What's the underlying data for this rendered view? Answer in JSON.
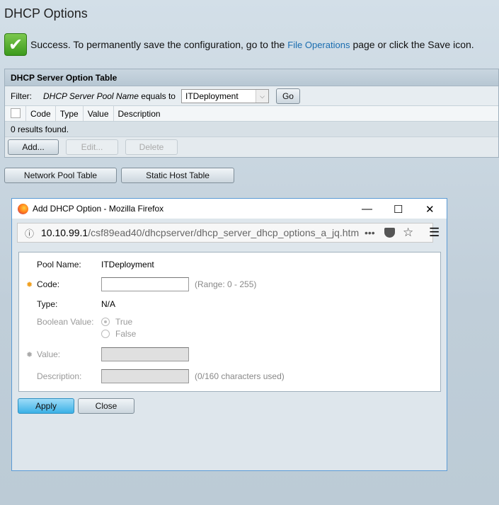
{
  "page": {
    "title": "DHCP Options",
    "success_text": "Success. To permanently save the configuration, go to the",
    "success_link": "File Operations",
    "success_tail": "page or click the Save icon."
  },
  "table": {
    "title": "DHCP Server Option Table",
    "filter_label": "Filter:",
    "filter_field": "DHCP Server Pool Name",
    "filter_op": "equals to",
    "filter_value": "ITDeployment",
    "go": "Go",
    "columns": [
      "Code",
      "Type",
      "Value",
      "Description"
    ],
    "results": "0 results found.",
    "add": "Add...",
    "edit": "Edit...",
    "delete": "Delete"
  },
  "nav": {
    "network_pool": "Network Pool Table",
    "static_host": "Static Host Table"
  },
  "popup": {
    "title": "Add DHCP Option - Mozilla Firefox",
    "url_host": "10.10.99.1",
    "url_path": "/csf89ead40/dhcpserver/dhcp_server_dhcp_options_a_jq.htm",
    "pool_label": "Pool Name:",
    "pool_value": "ITDeployment",
    "code_label": "Code:",
    "code_value": "",
    "code_hint": "(Range: 0 - 255)",
    "type_label": "Type:",
    "type_value": "N/A",
    "bool_label": "Boolean Value:",
    "true_label": "True",
    "false_label": "False",
    "value_label": "Value:",
    "desc_label": "Description:",
    "desc_hint": "(0/160 characters used)",
    "apply": "Apply",
    "close": "Close"
  }
}
